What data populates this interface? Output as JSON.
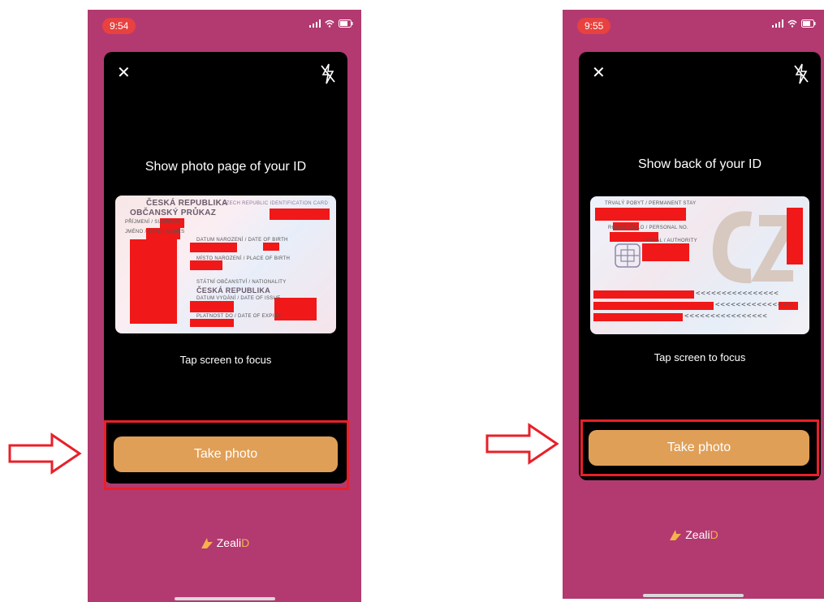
{
  "left": {
    "time": "9:54",
    "prompt": "Show photo page of your ID",
    "focus_hint": "Tap screen to focus",
    "button": "Take photo",
    "card": {
      "line1": "ČESKÁ REPUBLIKA",
      "line1b": "CZECH REPUBLIC  IDENTIFICATION CARD",
      "line2": "OBČANSKÝ PRŮKAZ",
      "nationality": "ČESKÁ REPUBLIKA"
    }
  },
  "right": {
    "time": "9:55",
    "prompt": "Show back of your ID",
    "focus_hint": "Tap screen to focus",
    "button": "Take photo",
    "mrz": [
      "<<<<<<<<<<<<<<<<",
      "<<<<<<<<<<<<<<<",
      "<<<<<<<<<<<<<<<<"
    ]
  },
  "brand": {
    "name": "Zeali",
    "suffix": "D"
  },
  "colors": {
    "phone_bg": "#b23a70",
    "button": "#e09f57",
    "highlight": "#e8202a",
    "status_time_bg": "#e8413f"
  }
}
